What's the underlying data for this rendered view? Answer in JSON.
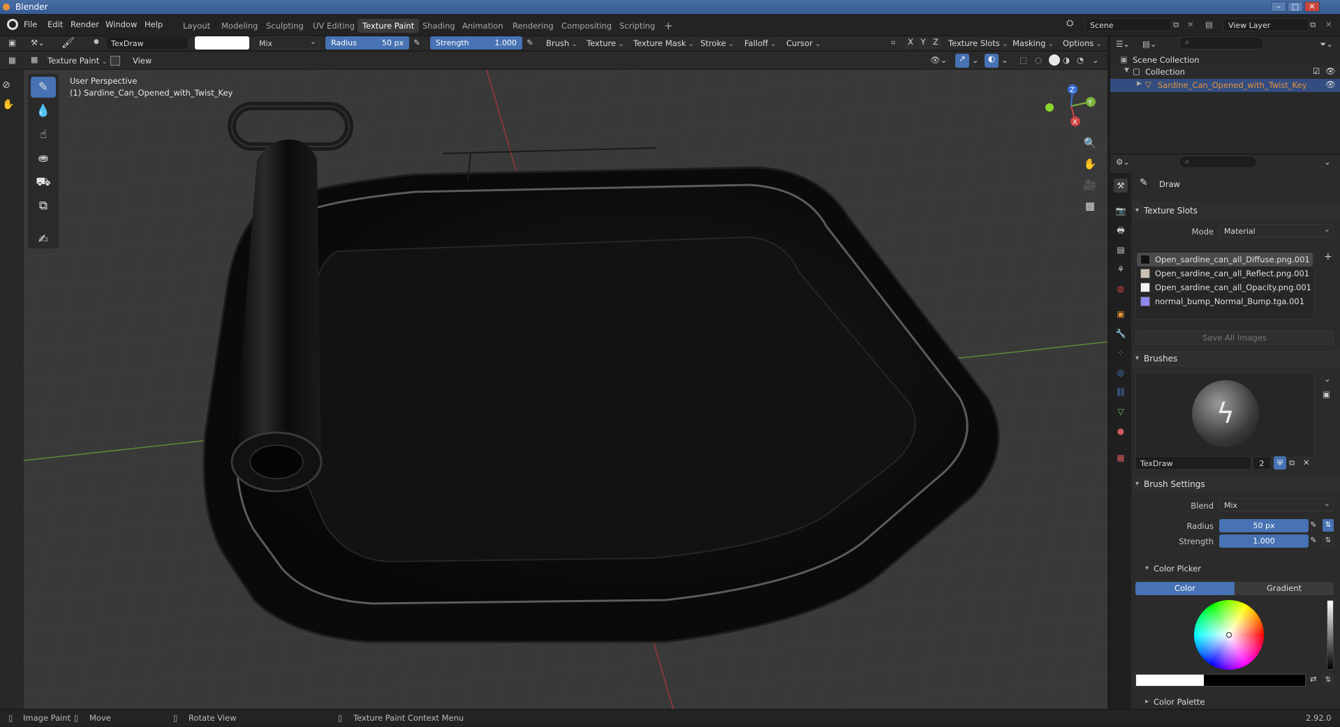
{
  "window": {
    "title": "Blender"
  },
  "menu": [
    "File",
    "Edit",
    "Render",
    "Window",
    "Help"
  ],
  "workspaces": [
    "Layout",
    "Modeling",
    "Sculpting",
    "UV Editing",
    "Texture Paint",
    "Shading",
    "Animation",
    "Rendering",
    "Compositing",
    "Scripting"
  ],
  "active_workspace": "Texture Paint",
  "add_workspace": "+",
  "scene": {
    "name": "Scene",
    "view_layer": "View Layer"
  },
  "tool_header": {
    "brush_name": "TexDraw",
    "blend": "Mix",
    "radius_label": "Radius",
    "radius_value": "50 px",
    "strength_label": "Strength",
    "strength_value": "1.000",
    "menus": [
      "Brush",
      "Texture",
      "Texture Mask",
      "Stroke",
      "Falloff",
      "Cursor"
    ],
    "axes": [
      "X",
      "Y",
      "Z"
    ],
    "right_menus": [
      "Texture Slots",
      "Masking",
      "Options"
    ]
  },
  "editor_header": {
    "mode": "Texture Paint",
    "view": "View"
  },
  "viewport": {
    "perspective": "User Perspective",
    "object": "(1) Sardine_Can_Opened_with_Twist_Key",
    "gizmo": {
      "z": "Z",
      "y": "Y",
      "x": "X"
    }
  },
  "outliner": {
    "scene_collection": "Scene Collection",
    "collection": "Collection",
    "object": "Sardine_Can_Opened_with_Twist_Key"
  },
  "properties": {
    "tool": "Draw",
    "texture_slots_title": "Texture Slots",
    "mode_label": "Mode",
    "mode_value": "Material",
    "slots": [
      {
        "name": "Open_sardine_can_all_Diffuse.png.001",
        "color": "#111111"
      },
      {
        "name": "Open_sardine_can_all_Reflect.png.001",
        "color": "#c9c0b2"
      },
      {
        "name": "Open_sardine_can_all_Opacity.png.001",
        "color": "#f2f2f2"
      },
      {
        "name": "normal_bump_Normal_Bump.tga.001",
        "color": "#8f87f0"
      }
    ],
    "save_all": "Save All Images",
    "brushes_title": "Brushes",
    "brush_name": "TexDraw",
    "brush_users": "2",
    "brush_settings_title": "Brush Settings",
    "blend_label": "Blend",
    "blend_value": "Mix",
    "radius_label": "Radius",
    "radius_value": "50 px",
    "strength_label": "Strength",
    "strength_value": "1.000",
    "color_picker_title": "Color Picker",
    "color_tab": "Color",
    "gradient_tab": "Gradient",
    "color_palette_title": "Color Palette"
  },
  "status": {
    "left": "Image Paint",
    "move": "Move",
    "rotate": "Rotate View",
    "context": "Texture Paint Context Menu",
    "version": "2.92.0"
  },
  "colors": {
    "accent": "#4772b3",
    "header": "#2a2a2a",
    "viewport": "#393939",
    "highlight": "#e8913a"
  }
}
